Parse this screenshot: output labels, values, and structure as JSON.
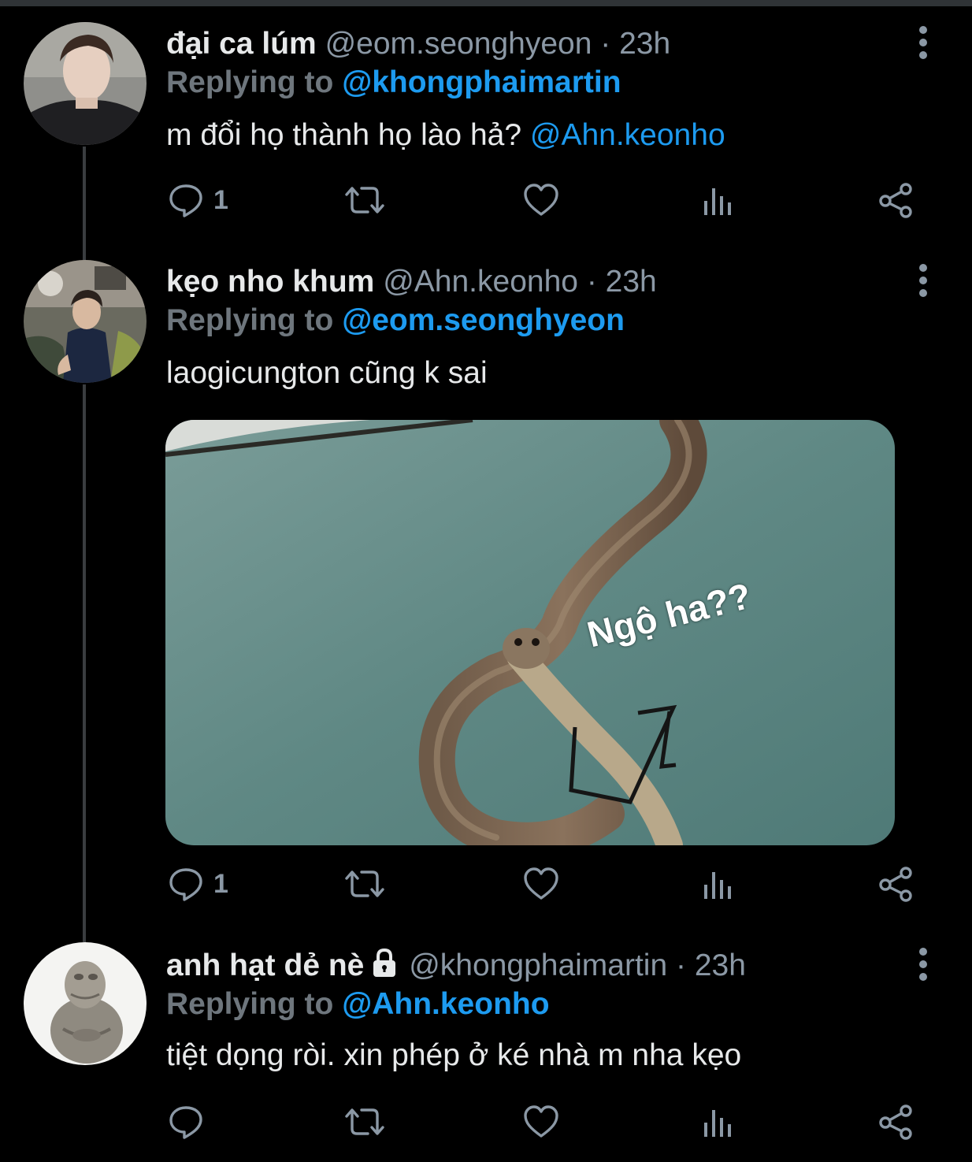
{
  "thread": {
    "tweets": [
      {
        "display_name": "đại ca lúm",
        "handle": "@eom.seonghyeon",
        "separator": "·",
        "time": "23h",
        "replying_label": "Replying to",
        "replying_to": "@khongphaimartin",
        "text": "m đổi họ thành họ lào hả?",
        "text_mention": "@Ahn.keonho",
        "reply_count": "1",
        "avatar": "person-photo-icon"
      },
      {
        "display_name": "kẹo nho khum",
        "handle": "@Ahn.keonho",
        "separator": "·",
        "time": "23h",
        "replying_label": "Replying to",
        "replying_to": "@eom.seonghyeon",
        "text": "laogicungton cũng k sai",
        "media_caption": "Ngộ ha??",
        "reply_count": "1",
        "avatar": "person-photo-icon"
      },
      {
        "display_name": "anh hạt dẻ nè",
        "protected_icon": "lock-icon",
        "handle": "@khongphaimartin",
        "separator": "·",
        "time": "23h",
        "replying_label": "Replying to",
        "replying_to": "@Ahn.keonho",
        "text": "tiệt dọng ròi. xin phép ở ké nhà m nha kẹo",
        "reply_count": "",
        "avatar": "figure-icon"
      }
    ]
  },
  "actions": [
    "reply-icon",
    "retweet-icon",
    "like-icon",
    "analytics-icon",
    "share-icon"
  ],
  "colors": {
    "background": "#000000",
    "primary_text": "#e7e9ea",
    "secondary_text": "#8b98a5",
    "link": "#1d9bf0",
    "thread_line": "#3a3d40"
  }
}
